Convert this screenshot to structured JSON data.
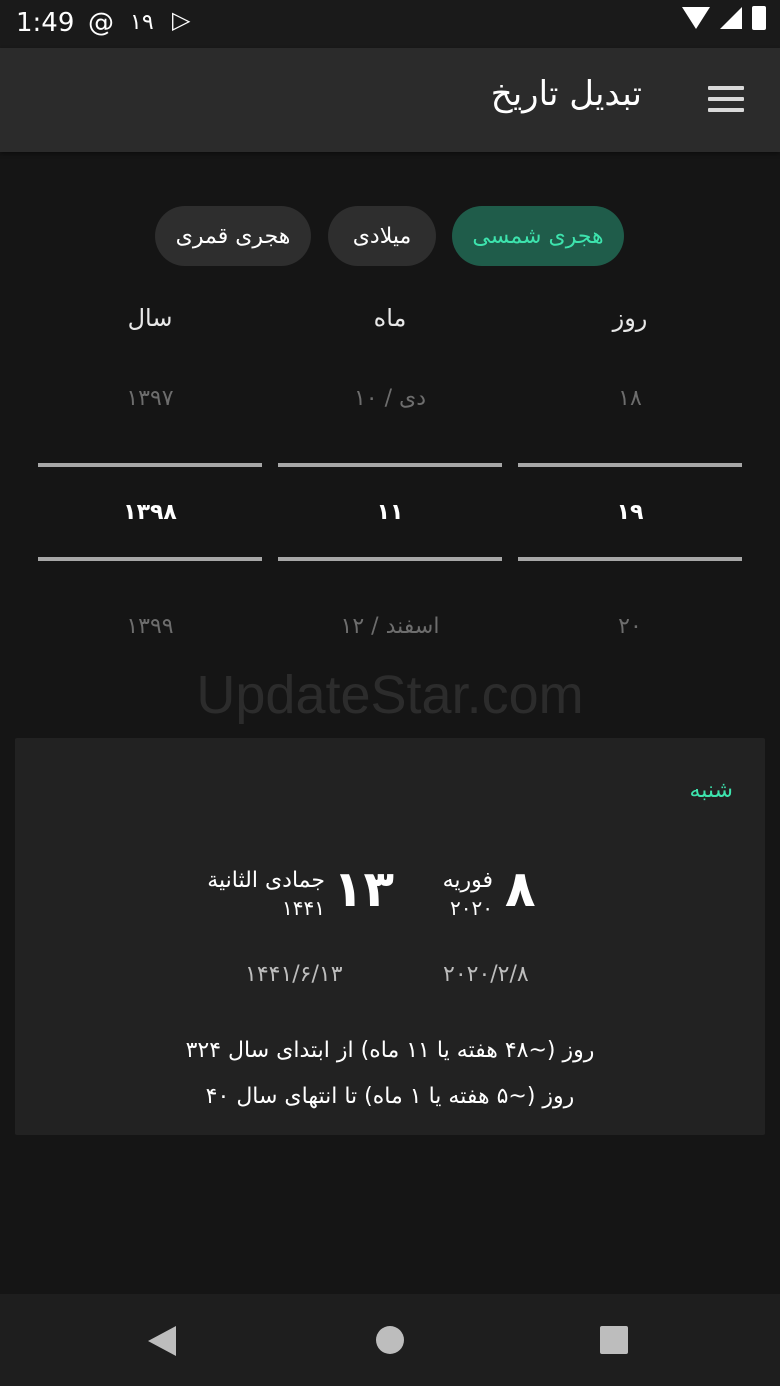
{
  "status_bar": {
    "time": "1:49",
    "notification_count": "۱۹",
    "icons": [
      "at-sign-icon",
      "play-store-icon",
      "wifi-icon",
      "signal-icon",
      "battery-icon"
    ]
  },
  "app_bar": {
    "title": "تبدیل تاریخ",
    "menu_icon": "hamburger-menu-icon"
  },
  "calendar_tabs": [
    {
      "label": "هجری شمسی",
      "active": true
    },
    {
      "label": "میلادی",
      "active": false
    },
    {
      "label": "هجری قمری",
      "active": false
    }
  ],
  "picker": {
    "labels": {
      "day": "روز",
      "month": "ماه",
      "year": "سال"
    },
    "day": {
      "prev": "۱۸",
      "selected": "۱۹",
      "next": "۲۰"
    },
    "month": {
      "prev": "دی / ۱۰",
      "selected": "۱۱",
      "next": "اسفند / ۱۲"
    },
    "year": {
      "prev": "۱۳۹۷",
      "selected": "۱۳۹۸",
      "next": "۱۳۹۹"
    }
  },
  "watermark": "UpdateStar.com",
  "result": {
    "weekday": "شنبه",
    "gregorian": {
      "day": "۸",
      "month": "فوریه",
      "year": "۲۰۲۰",
      "short": "۲۰۲۰/۲/۸"
    },
    "hijri": {
      "day": "۱۳",
      "month": "جمادی الثانیة",
      "year": "۱۴۴۱",
      "short": "۱۴۴۱/۶/۱۳"
    },
    "since_start": "۳۲۴ روز (~۴۸ هفته یا ۱۱ ماه) از ابتدای سال",
    "until_end": "۴۰ روز (~۵ هفته یا ۱ ماه) تا انتهای سال"
  },
  "colors": {
    "accent": "#3de3ad",
    "active_chip_bg": "#1f5c4a",
    "background": "#151515",
    "card": "#222222"
  }
}
